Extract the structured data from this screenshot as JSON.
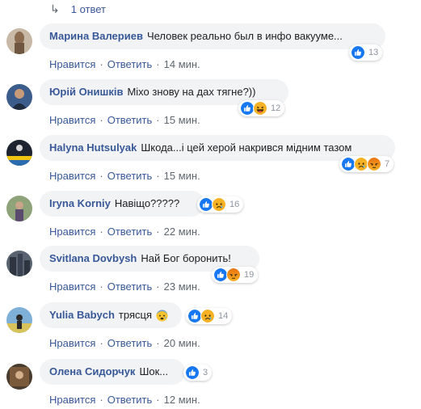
{
  "top": {
    "replies_label": "1 ответ"
  },
  "labels": {
    "like": "Нравится",
    "reply": "Ответить",
    "dot": "·"
  },
  "comments": [
    {
      "author": "Марина Валериев",
      "text": "Человек реально был в инфо вакууме...",
      "reactions": [
        "like"
      ],
      "count": "13",
      "time": "14 мин."
    },
    {
      "author": "Юрій Онишків",
      "text": "Міхо знову на дах тягне?))",
      "reactions": [
        "like",
        "haha"
      ],
      "count": "12",
      "time": "15 мин."
    },
    {
      "author": "Halyna Hutsulyak",
      "text": "Шкода...і цей херой накрився мідним тазом",
      "reactions": [
        "like",
        "sad",
        "angry"
      ],
      "count": "7",
      "time": "15 мин."
    },
    {
      "author": "Iryna Korniy",
      "text": "Навіщо?????",
      "reactions": [
        "like",
        "sad"
      ],
      "count": "16",
      "time": "22 мин."
    },
    {
      "author": "Svitlana Dovbysh",
      "text": "Най Бог боронить!",
      "reactions": [
        "like",
        "angry"
      ],
      "count": "19",
      "time": "23 мин."
    },
    {
      "author": "Yulia Babych",
      "text": "трясця",
      "reactions": [
        "like",
        "sad"
      ],
      "count": "14",
      "time": "20 мин.",
      "inline_emoji": "anxious-face"
    },
    {
      "author": "Олена Сидорчук",
      "text": "Шок...",
      "reactions": [
        "like"
      ],
      "count": "3",
      "time": "12 мин."
    }
  ],
  "colors": {
    "link": "#385898",
    "bubble": "#f2f3f5",
    "meta": "#606770",
    "like_blue": "#1877f2"
  }
}
